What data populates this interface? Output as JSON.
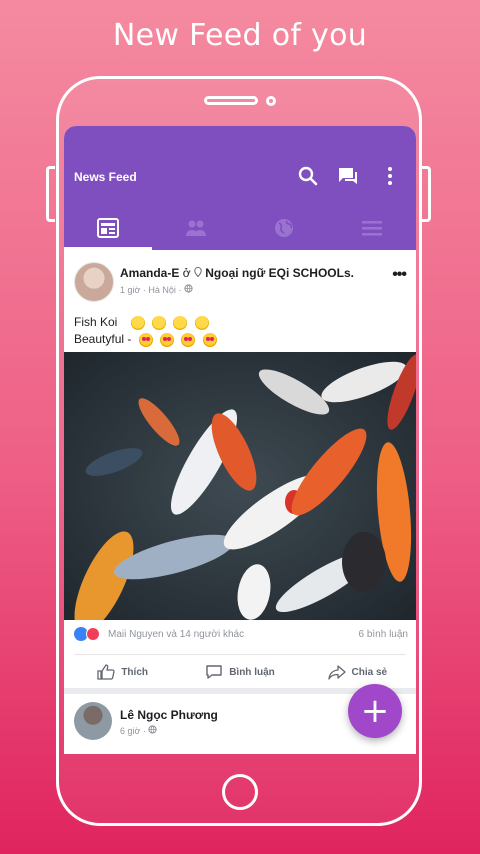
{
  "headline": "New Feed of you",
  "appbar": {
    "title": "News Feed",
    "icons": [
      "search-icon",
      "messages-icon",
      "more-vert-icon"
    ],
    "tabs": [
      {
        "name": "newsfeed-tab",
        "icon": "newspaper-icon",
        "active": true
      },
      {
        "name": "friends-tab",
        "icon": "people-icon",
        "active": false
      },
      {
        "name": "explore-tab",
        "icon": "globe-icon",
        "active": false
      },
      {
        "name": "menu-tab",
        "icon": "menu-icon",
        "active": false
      }
    ]
  },
  "post": {
    "author": "Amanda-E",
    "at_word": "ở",
    "location": "Ngoại ngữ EQi SCHOOLs.",
    "meta": "1 giờ · Hà Nội ·",
    "line1": "Fish Koi",
    "line2": "Beautyful -",
    "reactions_text": "Maii Nguyen và 14 người khác",
    "comments_text": "6 bình luận",
    "actions": {
      "like": "Thích",
      "comment": "Bình luận",
      "share": "Chia sẻ"
    }
  },
  "post2": {
    "author": "Lê Ngọc Phương",
    "meta": "6 giờ ·"
  },
  "colors": {
    "appbar": "#7f4fbf",
    "fab": "#a147c9",
    "background_top": "#f48aa0",
    "background_bottom": "#e0245e"
  },
  "fab": {
    "label": "+"
  }
}
